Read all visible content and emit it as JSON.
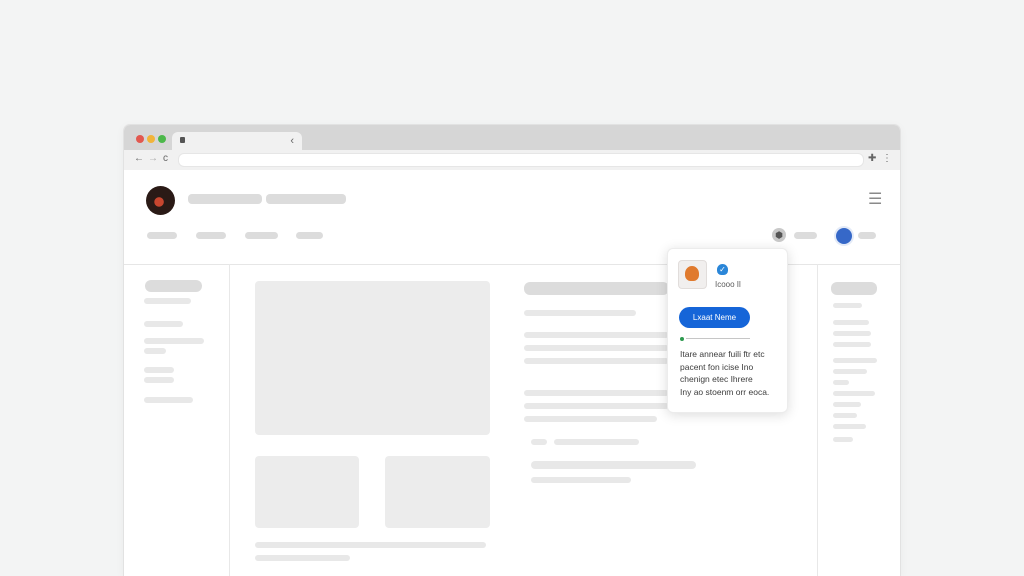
{
  "window": {
    "traffic_lights": [
      "#e2584f",
      "#f1b43a",
      "#4cb84a"
    ],
    "tab": {
      "close_glyph": "‹"
    }
  },
  "toolbar": {
    "back_glyph": "←",
    "forward_glyph": "→",
    "reload_glyph": "c",
    "extension_glyph": "✚",
    "menu_glyph": "⋮",
    "address": ""
  },
  "header": {
    "menu_glyph": "☰",
    "shield_glyph": "⬢"
  },
  "popup": {
    "subtitle": "Icooo Il",
    "button_label": "Lxaat Neme",
    "body": "Itare annear fuili ftr etc\npacent fon icise Ino\nchenign etec Ihrere\nIny ao stoenm orr eoca."
  }
}
